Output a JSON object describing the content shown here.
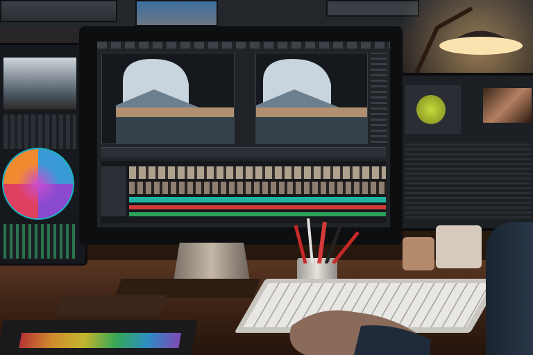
{
  "scene": {
    "description_kind": "photo",
    "colors": {
      "lamp_glow": "#f3c27a",
      "desk_wood": "#4a2e1c",
      "timeline_teal": "#1fb3a3",
      "timeline_red": "#d23a3a",
      "color_wheel_center": "#c84fd0",
      "scope_green": "#c6d83a"
    },
    "objects": [
      {
        "name": "main-monitor",
        "content": "video-editor-ui"
      },
      {
        "name": "left-tablet",
        "content": "color-wheel"
      },
      {
        "name": "right-monitor",
        "content": "color-grading-scope"
      },
      {
        "name": "keyboard"
      },
      {
        "name": "desk-lamp"
      },
      {
        "name": "pen-cup"
      },
      {
        "name": "hand"
      },
      {
        "name": "control-surface"
      }
    ]
  }
}
